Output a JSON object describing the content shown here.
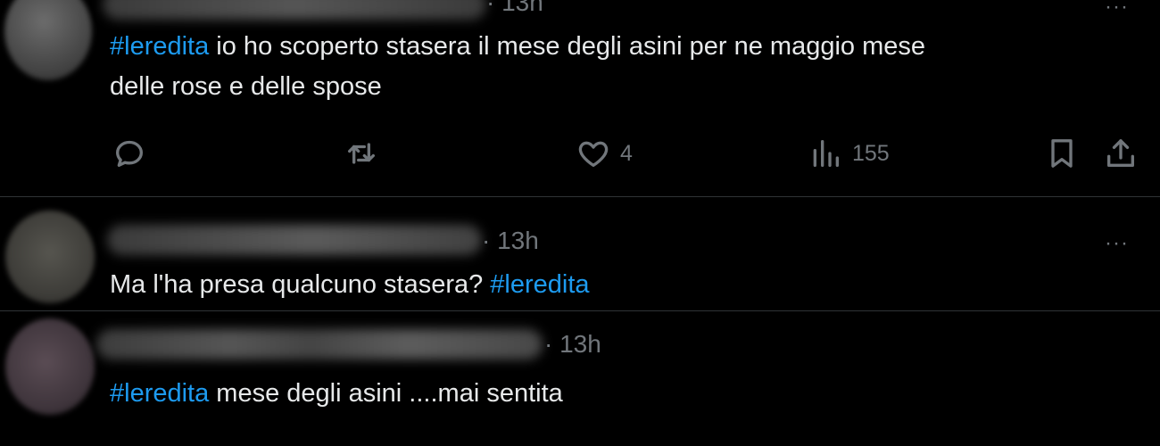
{
  "tweets": [
    {
      "time": "· 13h",
      "more": "···",
      "hashtag": "#leredita",
      "text_after": " io ho scoperto stasera il mese degli asini per ne maggio mese\ndelle rose e delle spose",
      "actions": {
        "reply": {
          "icon": "reply-icon"
        },
        "retweet": {
          "icon": "retweet-icon"
        },
        "like": {
          "icon": "heart-icon",
          "count": "4"
        },
        "views": {
          "icon": "views-icon",
          "count": "155"
        },
        "bookmark": {
          "icon": "bookmark-icon"
        },
        "share": {
          "icon": "share-icon"
        }
      }
    },
    {
      "time": "· 13h",
      "more": "···",
      "text_before": "Ma l'ha presa qualcuno stasera? ",
      "hashtag": "#leredita"
    },
    {
      "time": "· 13h",
      "hashtag": "#leredita",
      "text_after": " mese degli asini ....mai sentita"
    }
  ],
  "colors": {
    "background": "#000000",
    "text": "#e7e9ea",
    "muted": "#71767b",
    "hashtag": "#1d9bf0",
    "divider": "#2f3336"
  }
}
